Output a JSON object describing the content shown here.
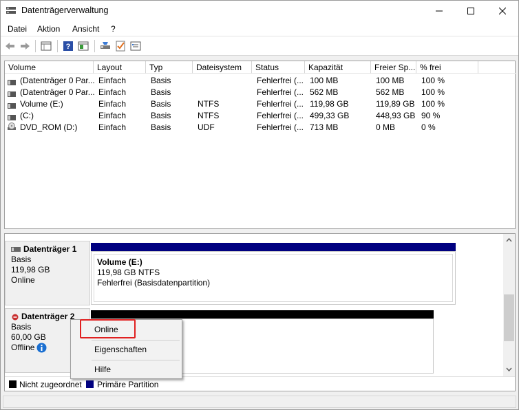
{
  "window": {
    "title": "Datenträgerverwaltung",
    "minimize_symbol": "—",
    "maximize_symbol": "☐",
    "close_symbol": "✕"
  },
  "menu": [
    "Datei",
    "Aktion",
    "Ansicht",
    "?"
  ],
  "toolbar_icons": [
    "back-icon",
    "forward-icon",
    "volume-list-icon",
    "help-icon",
    "properties-icon",
    "disk-icon",
    "check-icon",
    "settings-icon"
  ],
  "table": {
    "columns": [
      "Volume",
      "Layout",
      "Typ",
      "Dateisystem",
      "Status",
      "Kapazität",
      "Freier Sp...",
      "% frei"
    ],
    "rows": [
      {
        "icon": "disk-icon",
        "volume": "(Datenträger 0 Par...",
        "layout": "Einfach",
        "typ": "Basis",
        "fs": "",
        "status": "Fehlerfrei (...",
        "cap": "100 MB",
        "free": "100 MB",
        "pct": "100 %"
      },
      {
        "icon": "disk-icon",
        "volume": "(Datenträger 0 Par...",
        "layout": "Einfach",
        "typ": "Basis",
        "fs": "",
        "status": "Fehlerfrei (...",
        "cap": "562 MB",
        "free": "562 MB",
        "pct": "100 %"
      },
      {
        "icon": "disk-icon",
        "volume": "Volume (E:)",
        "layout": "Einfach",
        "typ": "Basis",
        "fs": "NTFS",
        "status": "Fehlerfrei (...",
        "cap": "119,98 GB",
        "free": "119,89 GB",
        "pct": "100 %"
      },
      {
        "icon": "disk-icon",
        "volume": "(C:)",
        "layout": "Einfach",
        "typ": "Basis",
        "fs": "NTFS",
        "status": "Fehlerfrei (...",
        "cap": "499,33 GB",
        "free": "448,93 GB",
        "pct": "90 %"
      },
      {
        "icon": "dvd-icon",
        "volume": "DVD_ROM (D:)",
        "layout": "Einfach",
        "typ": "Basis",
        "fs": "UDF",
        "status": "Fehlerfrei (...",
        "cap": "713 MB",
        "free": "0 MB",
        "pct": "0 %"
      }
    ]
  },
  "disks": [
    {
      "name": "Datenträger 1",
      "type": "Basis",
      "size": "119,98 GB",
      "state": "Online",
      "partition": {
        "title": "Volume  (E:)",
        "size": "119,98 GB NTFS",
        "status": "Fehlerfrei (Basisdatenpartition)"
      }
    },
    {
      "name": "Datenträger 2",
      "type": "Basis",
      "size": "60,00 GB",
      "state": "Offline"
    }
  ],
  "legend": [
    {
      "color": "#000000",
      "label": "Nicht zugeordnet"
    },
    {
      "color": "#000080",
      "label": "Primäre Partition"
    }
  ],
  "context_menu": [
    "Online",
    "Eigenschaften",
    "Hilfe"
  ],
  "colors": {
    "primary_partition": "#000080",
    "unallocated": "#000000",
    "highlight": "#e02020",
    "info": "#1a6fd1"
  }
}
